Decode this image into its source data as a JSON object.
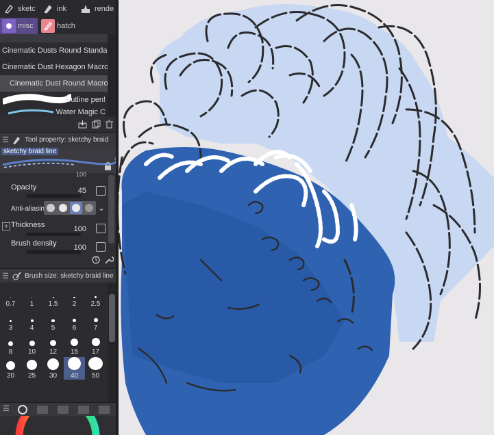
{
  "subtool_tabs": [
    {
      "label": "sketc",
      "icon": "pen-icon"
    },
    {
      "label": "ink",
      "icon": "pen-icon"
    },
    {
      "label": "rende",
      "icon": "brush-icon"
    },
    {
      "label": "misc",
      "icon": "misc-icon"
    },
    {
      "label": "hatch",
      "icon": "hatch-icon"
    }
  ],
  "brush_list": {
    "items": [
      "Cinematic Dusts Round Standa",
      "Cinematic Dust Hexagon Macro",
      "Cinematic Dust Round Macro",
      "outline pen!",
      "Water Magic C"
    ],
    "selected_index": 2
  },
  "tool_property": {
    "title": "Tool property: sketchy braid",
    "preview_name": "sketchy braid line",
    "partial_value": "100",
    "opacity_label": "Opacity",
    "opacity_value": "45",
    "antialiasing_label": "Anti-aliasing",
    "thickness_label": "Thickness",
    "thickness_value": "100",
    "brush_density_label": "Brush density",
    "brush_density_value": "100"
  },
  "brush_size": {
    "title": "Brush size: sketchy braid line",
    "sizes": [
      "0.7",
      "1",
      "1.5",
      "2",
      "2.5",
      "3",
      "4",
      "5",
      "6",
      "7",
      "8",
      "10",
      "12",
      "15",
      "17",
      "20",
      "25",
      "30",
      "40",
      "50"
    ],
    "selected": "40"
  },
  "colors": {
    "panel_bg": "#2e2e33",
    "canvas_bg": "#e9e7ea",
    "hair_fill": "#c8d8f2",
    "face_fill": "#2f63b2",
    "face_dark": "#1e4a96",
    "line": "#2b2b2d"
  }
}
